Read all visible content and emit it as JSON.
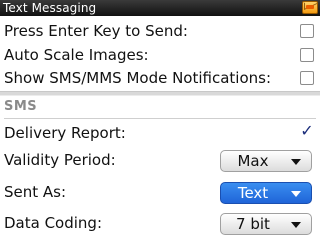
{
  "titlebar": {
    "title": "Text Messaging",
    "icon": "envelope-icon"
  },
  "options": [
    {
      "label": "Press Enter Key to Send:",
      "checked": false
    },
    {
      "label": "Auto Scale Images:",
      "checked": false
    },
    {
      "label": "Show SMS/MMS Mode Notifications:",
      "checked": false
    }
  ],
  "sms_section": {
    "title": "SMS",
    "delivery_report": {
      "label": "Delivery Report:",
      "checked": true
    },
    "validity_period": {
      "label": "Validity Period:",
      "value": "Max"
    },
    "sent_as": {
      "label": "Sent As:",
      "value": "Text"
    },
    "data_coding": {
      "label": "Data Coding:",
      "value": "7 bit"
    }
  },
  "colors": {
    "selected_dropdown": "#1f64d8",
    "checkmark": "#1a2c7a"
  }
}
